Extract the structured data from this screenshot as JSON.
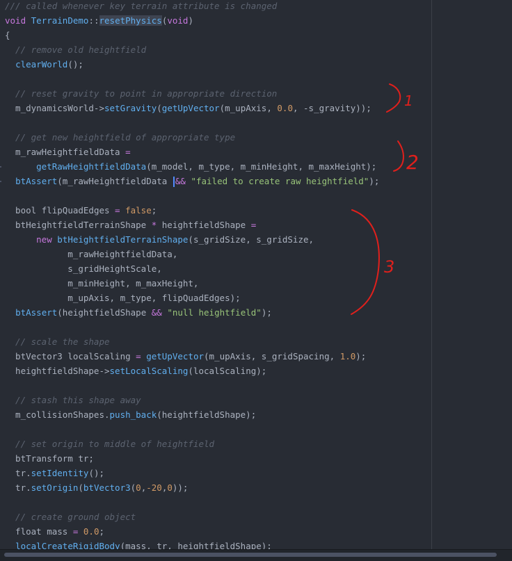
{
  "editor": {
    "lines": [
      [
        {
          "t": "/// called whenever key terrain attribute is changed",
          "c": "c"
        }
      ],
      [
        {
          "t": "void ",
          "c": "k"
        },
        {
          "t": "TerrainDemo",
          "c": "f"
        },
        {
          "t": "::",
          "c": "p"
        },
        {
          "t": "resetPhysics",
          "c": "f",
          "hl": true
        },
        {
          "t": "(",
          "c": "p"
        },
        {
          "t": "void",
          "c": "k"
        },
        {
          "t": ")",
          "c": "p"
        }
      ],
      [
        {
          "t": "{",
          "c": "p"
        }
      ],
      [
        {
          "t": "  // remove old heightfield",
          "c": "c"
        }
      ],
      [
        {
          "t": "  ",
          "c": "p"
        },
        {
          "t": "clearWorld",
          "c": "f"
        },
        {
          "t": "();",
          "c": "p"
        }
      ],
      [],
      [
        {
          "t": "  // reset gravity to point in appropriate direction",
          "c": "c"
        }
      ],
      [
        {
          "t": "  m_dynamicsWorld->",
          "c": "v"
        },
        {
          "t": "setGravity",
          "c": "f"
        },
        {
          "t": "(",
          "c": "p"
        },
        {
          "t": "getUpVector",
          "c": "f"
        },
        {
          "t": "(m_upAxis, ",
          "c": "v"
        },
        {
          "t": "0.0",
          "c": "n"
        },
        {
          "t": ", -s_gravity));",
          "c": "v"
        }
      ],
      [],
      [
        {
          "t": "  // get new heightfield of appropriate type",
          "c": "c"
        }
      ],
      [
        {
          "t": "  m_rawHeightfieldData ",
          "c": "v"
        },
        {
          "t": "=",
          "c": "k"
        }
      ],
      [
        {
          "t": "      ",
          "c": "p"
        },
        {
          "t": "getRawHeightfieldData",
          "c": "f"
        },
        {
          "t": "(m_model, m_type, m_minHeight, m_maxHeight);",
          "c": "v"
        }
      ],
      [
        {
          "t": "  ",
          "c": "p"
        },
        {
          "t": "btAssert",
          "c": "f"
        },
        {
          "t": "(m_rawHeightfieldData ",
          "c": "v"
        },
        {
          "t": "",
          "c": "cursor"
        },
        {
          "t": "&&",
          "c": "k"
        },
        {
          "t": " ",
          "c": "p"
        },
        {
          "t": "\"failed to create raw heightfield\"",
          "c": "s"
        },
        {
          "t": ");",
          "c": "p"
        }
      ],
      [],
      [
        {
          "t": "  bool ",
          "c": "v"
        },
        {
          "t": "flipQuadEdges ",
          "c": "v"
        },
        {
          "t": "=",
          "c": "k"
        },
        {
          "t": " ",
          "c": "p"
        },
        {
          "t": "false",
          "c": "n"
        },
        {
          "t": ";",
          "c": "p"
        }
      ],
      [
        {
          "t": "  btHeightfieldTerrainShape ",
          "c": "v"
        },
        {
          "t": "*",
          "c": "k"
        },
        {
          "t": " heightfieldShape ",
          "c": "v"
        },
        {
          "t": "=",
          "c": "k"
        }
      ],
      [
        {
          "t": "      ",
          "c": "p"
        },
        {
          "t": "new",
          "c": "k"
        },
        {
          "t": " ",
          "c": "p"
        },
        {
          "t": "btHeightfieldTerrainShape",
          "c": "f"
        },
        {
          "t": "(s_gridSize, s_gridSize,",
          "c": "v"
        }
      ],
      [
        {
          "t": "            m_rawHeightfieldData,",
          "c": "v"
        }
      ],
      [
        {
          "t": "            s_gridHeightScale,",
          "c": "v"
        }
      ],
      [
        {
          "t": "            m_minHeight, m_maxHeight,",
          "c": "v"
        }
      ],
      [
        {
          "t": "            m_upAxis, m_type, flipQuadEdges);",
          "c": "v"
        }
      ],
      [
        {
          "t": "  ",
          "c": "p"
        },
        {
          "t": "btAssert",
          "c": "f"
        },
        {
          "t": "(heightfieldShape ",
          "c": "v"
        },
        {
          "t": "&&",
          "c": "k"
        },
        {
          "t": " ",
          "c": "p"
        },
        {
          "t": "\"null heightfield\"",
          "c": "s"
        },
        {
          "t": ");",
          "c": "p"
        }
      ],
      [],
      [
        {
          "t": "  // scale the shape",
          "c": "c"
        }
      ],
      [
        {
          "t": "  btVector3 localScaling ",
          "c": "v"
        },
        {
          "t": "=",
          "c": "k"
        },
        {
          "t": " ",
          "c": "p"
        },
        {
          "t": "getUpVector",
          "c": "f"
        },
        {
          "t": "(m_upAxis, s_gridSpacing, ",
          "c": "v"
        },
        {
          "t": "1.0",
          "c": "n"
        },
        {
          "t": ");",
          "c": "p"
        }
      ],
      [
        {
          "t": "  heightfieldShape->",
          "c": "v"
        },
        {
          "t": "setLocalScaling",
          "c": "f"
        },
        {
          "t": "(localScaling);",
          "c": "v"
        }
      ],
      [],
      [
        {
          "t": "  // stash this shape away",
          "c": "c"
        }
      ],
      [
        {
          "t": "  m_collisionShapes.",
          "c": "v"
        },
        {
          "t": "push_back",
          "c": "f"
        },
        {
          "t": "(heightfieldShape);",
          "c": "v"
        }
      ],
      [],
      [
        {
          "t": "  // set origin to middle of heightfield",
          "c": "c"
        }
      ],
      [
        {
          "t": "  btTransform tr;",
          "c": "v"
        }
      ],
      [
        {
          "t": "  tr.",
          "c": "v"
        },
        {
          "t": "setIdentity",
          "c": "f"
        },
        {
          "t": "();",
          "c": "p"
        }
      ],
      [
        {
          "t": "  tr.",
          "c": "v"
        },
        {
          "t": "setOrigin",
          "c": "f"
        },
        {
          "t": "(",
          "c": "p"
        },
        {
          "t": "btVector3",
          "c": "f"
        },
        {
          "t": "(",
          "c": "p"
        },
        {
          "t": "0",
          "c": "n"
        },
        {
          "t": ",",
          "c": "p"
        },
        {
          "t": "-20",
          "c": "n"
        },
        {
          "t": ",",
          "c": "p"
        },
        {
          "t": "0",
          "c": "n"
        },
        {
          "t": "));",
          "c": "p"
        }
      ],
      [],
      [
        {
          "t": "  // create ground object",
          "c": "c"
        }
      ],
      [
        {
          "t": "  float mass ",
          "c": "v"
        },
        {
          "t": "=",
          "c": "k"
        },
        {
          "t": " ",
          "c": "p"
        },
        {
          "t": "0.0",
          "c": "n"
        },
        {
          "t": ";",
          "c": "p"
        }
      ],
      [
        {
          "t": "  ",
          "c": "p"
        },
        {
          "t": "localCreateRigidBody",
          "c": "f"
        },
        {
          "t": "(mass, tr, heightfieldShape);",
          "c": "v"
        }
      ]
    ]
  },
  "annotations": {
    "labels": [
      "1",
      "2",
      "3"
    ],
    "ink_color": "#e0201c"
  }
}
